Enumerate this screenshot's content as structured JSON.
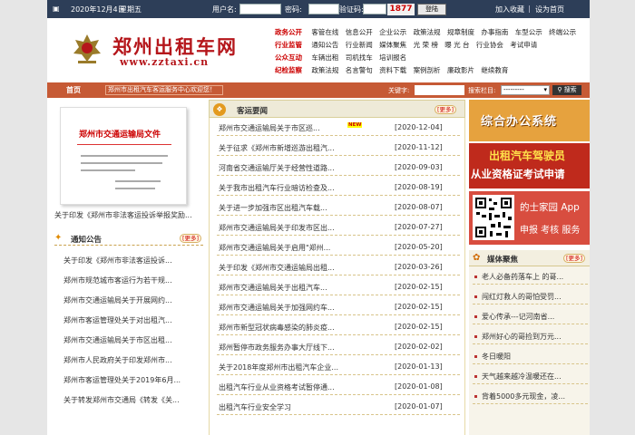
{
  "topbar": {
    "date": "2020年12月4日",
    "weekday": "星期五",
    "username_label": "用户名:",
    "password_label": "密码:",
    "captcha_label": "验证码:",
    "captcha_value": "1877",
    "login_label": "登陆",
    "favorite": "加入收藏",
    "set_home": "设为首页"
  },
  "header": {
    "brand": "郑州出租车网",
    "domain": "www.zztaxi.cn",
    "nav": [
      {
        "head": "政务公开",
        "items": [
          "客管在线",
          "信息公开",
          "企业公示",
          "政策法规",
          "规章制度",
          "办事指南",
          "车型公示",
          "终端公示"
        ]
      },
      {
        "head": "行业监管",
        "items": [
          "通知公告",
          "行业新闻",
          "媒体聚焦",
          "光 荣 榜",
          "曝 光 台",
          "行业协会",
          "考试申请"
        ]
      },
      {
        "head": "公众互动",
        "items": [
          "车辆出租",
          "司机找车",
          "培训报名"
        ]
      },
      {
        "head": "纪检监察",
        "items": [
          "政策法规",
          "名言警句",
          "资料下载",
          "案例剖析",
          "廉政影片",
          "继续教育"
        ]
      }
    ]
  },
  "searchbar": {
    "home": "首页",
    "welcome": "郑州市出租汽车客运服务中心欢迎您！",
    "keyword_label": "关键字:",
    "category_label": "搜索栏目:",
    "category_value": "---------",
    "search_label": "搜索"
  },
  "left": {
    "doc_title": "郑州市交通运输局文件",
    "doc_caption": "关于印发《郑州市非法客运投诉举报奖励...",
    "notice_title": "通知公告",
    "more": "[更多]",
    "notices": [
      "关于印发《郑州市非法客运投诉...",
      "郑州市规范城市客运行为若干规...",
      "郑州市交通运输局关于开展网约...",
      "郑州市客运管理处关于对出租汽...",
      "郑州市交通运输局关于市区出租...",
      "郑州市人民政府关于印发郑州市...",
      "郑州市客运管理处关于2019年6月...",
      "关于转发郑州市交通局《转发《关..."
    ]
  },
  "news": {
    "title": "客运要闻",
    "more": "[更多]",
    "new_badge": "NEW",
    "items": [
      {
        "title": "郑州市交通运输局关于市区巡...",
        "date": "[2020-12-04]",
        "is_new": true
      },
      {
        "title": "关于征求《郑州市新增巡游出租汽...",
        "date": "[2020-11-12]",
        "is_new": false
      },
      {
        "title": "河南省交通运输厅关于经营性道路...",
        "date": "[2020-09-03]",
        "is_new": false
      },
      {
        "title": "关于我市出租汽车行业暗访检查及...",
        "date": "[2020-08-19]",
        "is_new": false
      },
      {
        "title": "关于进一步加强市区出租汽车载...",
        "date": "[2020-08-07]",
        "is_new": false
      },
      {
        "title": "郑州市交通运输局关于印发市区出...",
        "date": "[2020-07-27]",
        "is_new": false
      },
      {
        "title": "郑州市交通运输局关于启用\"郑州...",
        "date": "[2020-05-20]",
        "is_new": false
      },
      {
        "title": "关于印发《郑州市交通运输局出租...",
        "date": "[2020-03-26]",
        "is_new": false
      },
      {
        "title": "郑州市交通运输局关于出租汽车...",
        "date": "[2020-02-15]",
        "is_new": false
      },
      {
        "title": "郑州市交通运输局关于加强网约车...",
        "date": "[2020-02-15]",
        "is_new": false
      },
      {
        "title": "郑州市新型冠状病毒感染的肺炎疫...",
        "date": "[2020-02-15]",
        "is_new": false
      },
      {
        "title": "郑州暂停市政务服务办事大厅线下...",
        "date": "[2020-02-02]",
        "is_new": false
      },
      {
        "title": "关于2018年度郑州市出租汽车企业...",
        "date": "[2020-01-13]",
        "is_new": false
      },
      {
        "title": "出租汽车行业从业资格考试暂停通...",
        "date": "[2020-01-08]",
        "is_new": false
      },
      {
        "title": "出租汽车行业安全学习",
        "date": "[2020-01-07]",
        "is_new": false
      }
    ]
  },
  "right": {
    "banner1": "综合办公系统",
    "banner2_line1": "出租汽车驾驶员",
    "banner2_line2": "从业资格证考试申请",
    "banner3_line1": "的士家园 App",
    "banner3_line2": "申报  考核  服务",
    "media_title": "媒体聚焦",
    "more": "[更多]",
    "media": [
      "老人必备药落车上 的哥...",
      "闯红灯救人的哥怕受罚...",
      "爱心传承---记河南省...",
      "郑州好心的哥捡到万元...",
      "冬日暖阳",
      "天气越来越冷温暖还在...",
      "背着5000多元现金，凌..."
    ]
  },
  "colors": {
    "topbar": "#2d3e58",
    "brand_red": "#b5161b",
    "search_bar": "#c65a35",
    "banner_orange": "#e6a23e",
    "banner_red": "#bf2a1c"
  }
}
